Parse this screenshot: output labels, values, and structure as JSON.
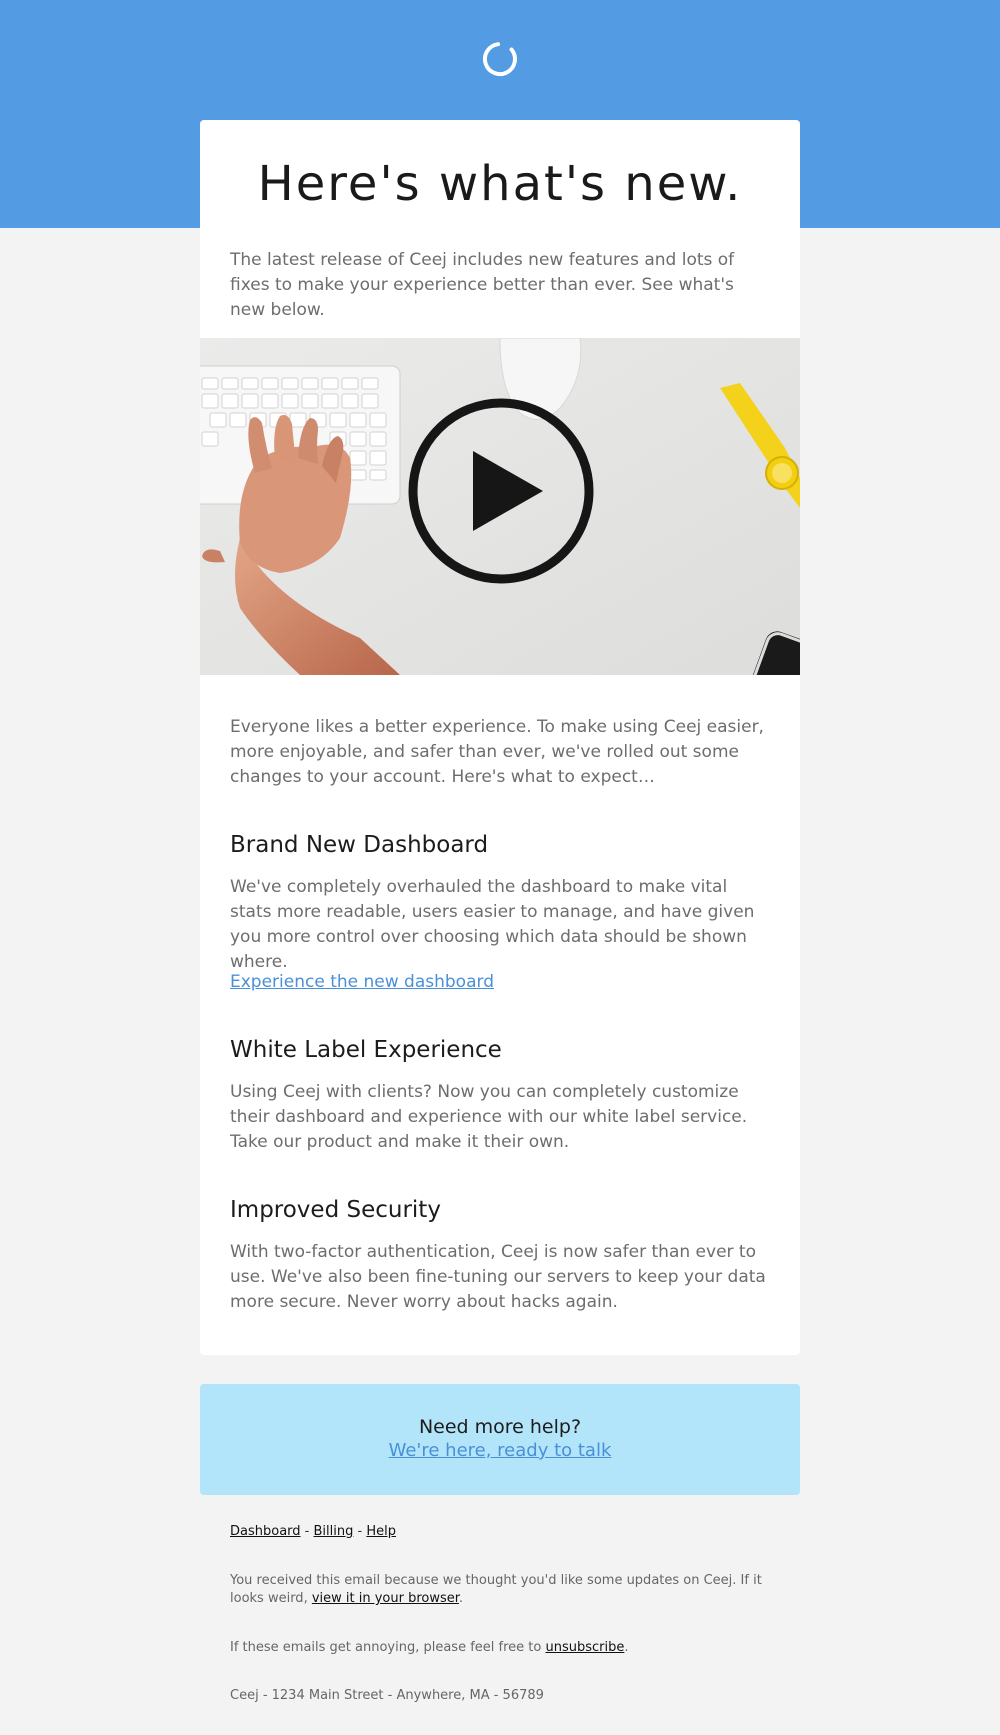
{
  "header": {
    "logo_icon": "spinner-arc-icon",
    "background_color": "#539be2"
  },
  "content": {
    "headline": "Here's what's new.",
    "intro": "The latest release of Ceej includes new features and lots of fixes to make your experience better than ever. See what's new below.",
    "hero": {
      "image_description": "keyboard-and-hand-photo",
      "overlay_icon": "play-button-icon"
    },
    "lead": "Everyone likes a better experience. To make using Ceej easier, more enjoyable, and safer than ever, we've rolled out some changes to your account. Here's what to expect…",
    "sections": [
      {
        "title": "Brand New Dashboard",
        "body": "We've completely overhauled the dashboard to make vital stats more readable, users easier to manage, and have given you more control over choosing which data should be shown where.",
        "link": "Experience the new dashboard"
      },
      {
        "title": "White Label Experience",
        "body": "Using Ceej with clients? Now you can completely customize their dashboard and experience with our white label service. Take our product and make it their own."
      },
      {
        "title": "Improved Security",
        "body": "With two-factor authentication, Ceej is now safer than ever to use. We've also been fine-tuning our servers to keep your data more secure. Never worry about hacks again."
      }
    ]
  },
  "help": {
    "title": "Need more help?",
    "link": "We're here, ready to talk",
    "background_color": "#b3e5fa"
  },
  "footer": {
    "nav": [
      "Dashboard",
      "Billing",
      "Help"
    ],
    "nav_separator": " - ",
    "why_text": "You received this email because we thought you'd like some updates on Ceej. If it looks weird,",
    "why_link": "view it in your browser",
    "why_end": ".",
    "unsub_text": "If these emails get annoying, please feel free to",
    "unsub_link": "unsubscribe",
    "unsub_end": ".",
    "address": "Ceej - 1234 Main Street - Anywhere, MA - 56789"
  },
  "colors": {
    "link": "#4a90d9",
    "body_text": "#6d6d6d",
    "page_background": "#f3f3f3"
  }
}
